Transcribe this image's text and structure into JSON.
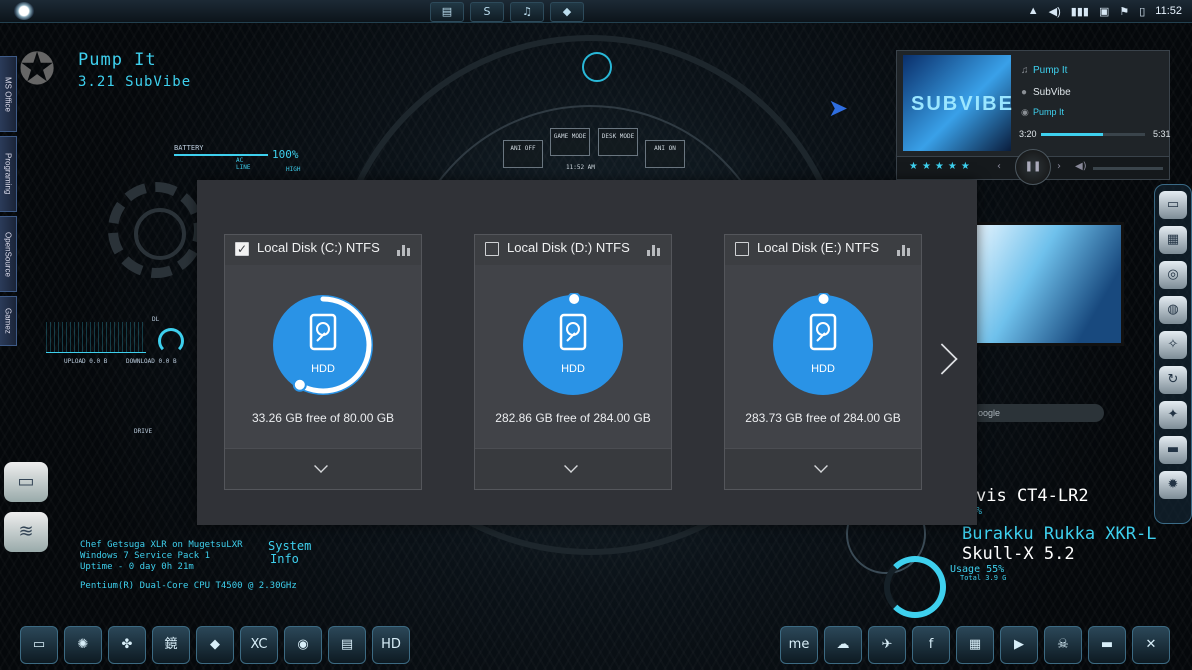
{
  "taskbar": {
    "clock": "11:52",
    "icons": [
      "folder-icon",
      "skype-icon",
      "music-icon",
      "drop-icon"
    ]
  },
  "sidebar_tabs": [
    "MS Office",
    "Programing",
    "OpenSource",
    "Gamez"
  ],
  "now_playing_widget": {
    "title": "Pump It",
    "subtitle": "3.21  SubVibe"
  },
  "battery": {
    "label": "BATTERY",
    "percent": "100%",
    "source": "AC LINE",
    "level": "HIGH"
  },
  "net": {
    "upload": "UPLOAD 0.0 B",
    "download": "DOWNLOAD 0.0 B",
    "dl_label": "DL"
  },
  "drive_mini": "DRIVE",
  "sysinfo": {
    "title_line1": "System",
    "title_line2": "Info",
    "lines": [
      "Chef Getsuga XLR on MugetsuLXR",
      "Windows 7 Service Pack 1",
      "Uptime - 0 day 0h 21m"
    ],
    "cpu": "Pentium(R) Dual-Core CPU    T4500  @ 2.30GHz"
  },
  "dial": {
    "buttons": [
      "ANI OFF",
      "GAME MODE",
      "DESK MODE",
      "ANI ON"
    ],
    "time": "11:52   AM"
  },
  "player": {
    "art_text": "SUBVIBE",
    "track": "Pump It",
    "artist": "SubVibe",
    "album": "Pump It",
    "elapsed": "3:20",
    "duration": "5:31",
    "progress": 0.6,
    "rating_stars": "★★★★★"
  },
  "right_widgets": {
    "search_placeholder": "oogle",
    "model": "vis CT4-LR2",
    "model_pct": "%",
    "brand": "Burakku Rukka XKR-L",
    "skin": "Skull-X 5.2",
    "usage": "Usage   55%",
    "usage_total": "Total 3.9 G"
  },
  "disk_panel": {
    "disks": [
      {
        "label": "Local Disk (C:) NTFS",
        "checked": true,
        "type": "HDD",
        "free_text": "33.26 GB free of 80.00 GB",
        "used_fraction": 0.584
      },
      {
        "label": "Local Disk (D:) NTFS",
        "checked": false,
        "type": "HDD",
        "free_text": "282.86 GB free of 284.00 GB",
        "used_fraction": 0.004
      },
      {
        "label": "Local Disk (E:) NTFS",
        "checked": false,
        "type": "HDD",
        "free_text": "283.73 GB free of 284.00 GB",
        "used_fraction": 0.001
      }
    ],
    "colors": {
      "panel_bg": "#303237",
      "card_bg": "#414348",
      "disk_blue": "#2a93e6",
      "ring_white": "#ffffff"
    }
  }
}
